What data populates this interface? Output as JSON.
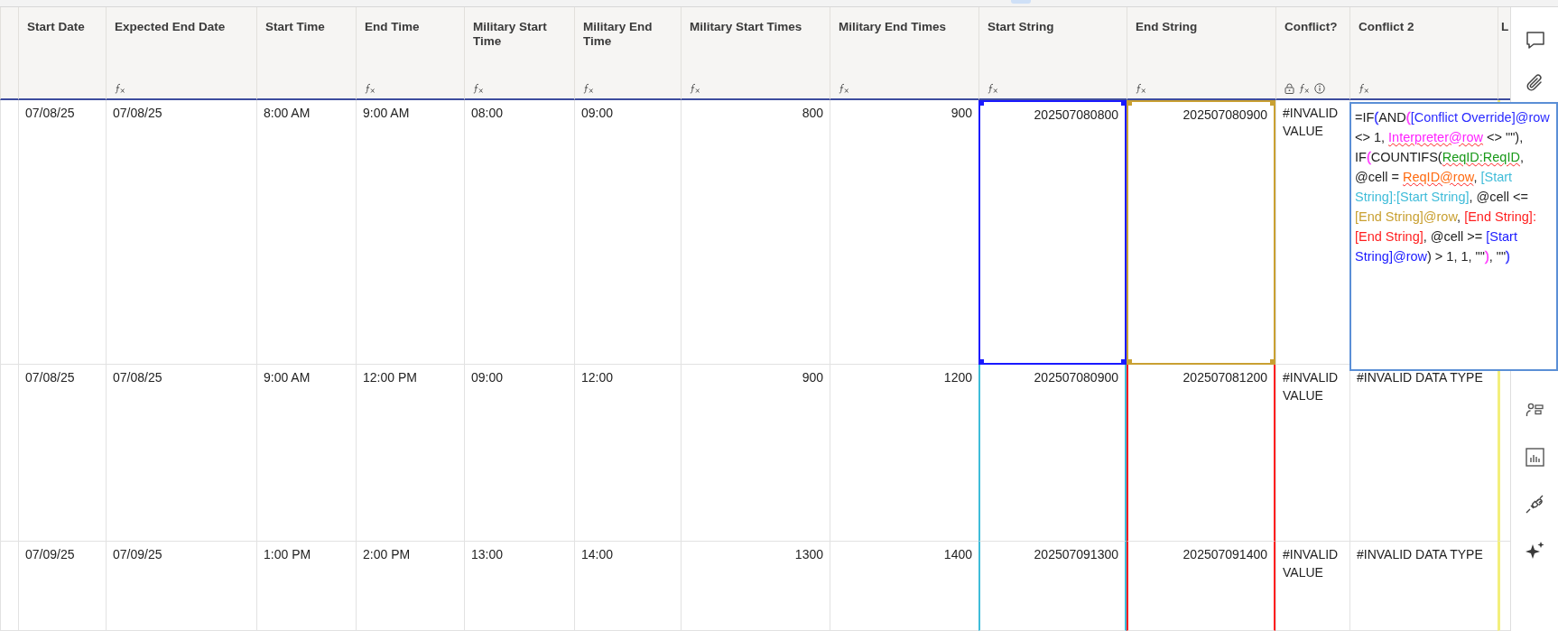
{
  "columns": [
    {
      "label": "Start Date",
      "kind": "text",
      "formula": false,
      "locked": false,
      "info": false
    },
    {
      "label": "Expected End Date",
      "kind": "text",
      "formula": true,
      "locked": false,
      "info": false
    },
    {
      "label": "Start Time",
      "kind": "text",
      "formula": false,
      "locked": false,
      "info": false
    },
    {
      "label": "End Time",
      "kind": "text",
      "formula": true,
      "locked": false,
      "info": false
    },
    {
      "label": "Military Start Time",
      "kind": "text",
      "formula": true,
      "locked": false,
      "info": false
    },
    {
      "label": "Military End Time",
      "kind": "text",
      "formula": true,
      "locked": false,
      "info": false
    },
    {
      "label": "Military Start Times",
      "kind": "number",
      "formula": true,
      "locked": false,
      "info": false
    },
    {
      "label": "Military End Times",
      "kind": "number",
      "formula": true,
      "locked": false,
      "info": false
    },
    {
      "label": "Start String",
      "kind": "number",
      "formula": true,
      "locked": false,
      "info": false,
      "color": "#3fbcd9"
    },
    {
      "label": "End String",
      "kind": "number",
      "formula": true,
      "locked": false,
      "info": false,
      "color": "#ff1f1f"
    },
    {
      "label": "Conflict?",
      "kind": "text",
      "formula": true,
      "locked": true,
      "info": true
    },
    {
      "label": "Conflict 2",
      "kind": "text",
      "formula": true,
      "locked": false,
      "info": false
    },
    {
      "label": "L",
      "kind": "text",
      "formula": false,
      "locked": false,
      "info": false,
      "color": "#f3ef7c"
    }
  ],
  "rows": [
    {
      "cells": [
        {
          "text": "07/08/25"
        },
        {
          "text": "07/08/25"
        },
        {
          "text": "8:00 AM"
        },
        {
          "text": "9:00 AM"
        },
        {
          "text": "08:00"
        },
        {
          "text": "09:00"
        },
        {
          "text": "800"
        },
        {
          "text": "900"
        },
        {
          "text": "202507080800",
          "color": "#1a1aff"
        },
        {
          "text": "202507080900",
          "color": "#c9a032"
        },
        {
          "text": "#INVALID VALUE"
        }
      ]
    },
    {
      "cells": [
        {
          "text": "07/08/25"
        },
        {
          "text": "07/08/25"
        },
        {
          "text": "9:00 AM"
        },
        {
          "text": "12:00 PM"
        },
        {
          "text": "09:00"
        },
        {
          "text": "12:00"
        },
        {
          "text": "900"
        },
        {
          "text": "1200"
        },
        {
          "text": "202507080900"
        },
        {
          "text": "202507081200"
        },
        {
          "text": "#INVALID VALUE"
        },
        {
          "text": "#INVALID DATA TYPE"
        }
      ]
    },
    {
      "cells": [
        {
          "text": "07/09/25"
        },
        {
          "text": "07/09/25"
        },
        {
          "text": "1:00 PM"
        },
        {
          "text": "2:00 PM"
        },
        {
          "text": "13:00"
        },
        {
          "text": "14:00"
        },
        {
          "text": "1300"
        },
        {
          "text": "1400"
        },
        {
          "text": "202507091300"
        },
        {
          "text": "202507091400"
        },
        {
          "text": "#INVALID VALUE"
        },
        {
          "text": "#INVALID DATA TYPE"
        }
      ]
    }
  ],
  "formula_editor": {
    "segments": [
      {
        "text": "=IF"
      },
      {
        "text": "(",
        "color": "#3a3aff"
      },
      {
        "text": "AND"
      },
      {
        "text": "(",
        "color": "#ff3cff"
      },
      {
        "text": "[Conflict Override]@row",
        "color": "#2a2aff"
      },
      {
        "text": " <> 1, "
      },
      {
        "text": "Interpreter@row",
        "color": "#ff22ff",
        "misspelled": true
      },
      {
        "text": " <> \"\"), IF"
      },
      {
        "text": "(",
        "color": "#ff3cff"
      },
      {
        "text": "COUNTIFS("
      },
      {
        "text": "ReqID:ReqID",
        "color": "#1a9a1a",
        "misspelled": true
      },
      {
        "text": ", @cell = "
      },
      {
        "text": "ReqID@row",
        "color": "#ff6a10",
        "misspelled": true
      },
      {
        "text": ", "
      },
      {
        "text": "[Start String]:[Start String]",
        "color": "#3fbcd9"
      },
      {
        "text": ", @cell <= "
      },
      {
        "text": "[End String]@row",
        "color": "#c9a032"
      },
      {
        "text": ", "
      },
      {
        "text": "[End String]:[End String]",
        "color": "#ff1f1f"
      },
      {
        "text": ", @cell >= "
      },
      {
        "text": "[Start String]@row",
        "color": "#1a1aff"
      },
      {
        "text": ") > 1, 1, \"\""
      },
      {
        "text": ")",
        "color": "#ff3cff"
      },
      {
        "text": ", \"\""
      },
      {
        "text": ")",
        "color": "#3a3aff"
      }
    ]
  }
}
